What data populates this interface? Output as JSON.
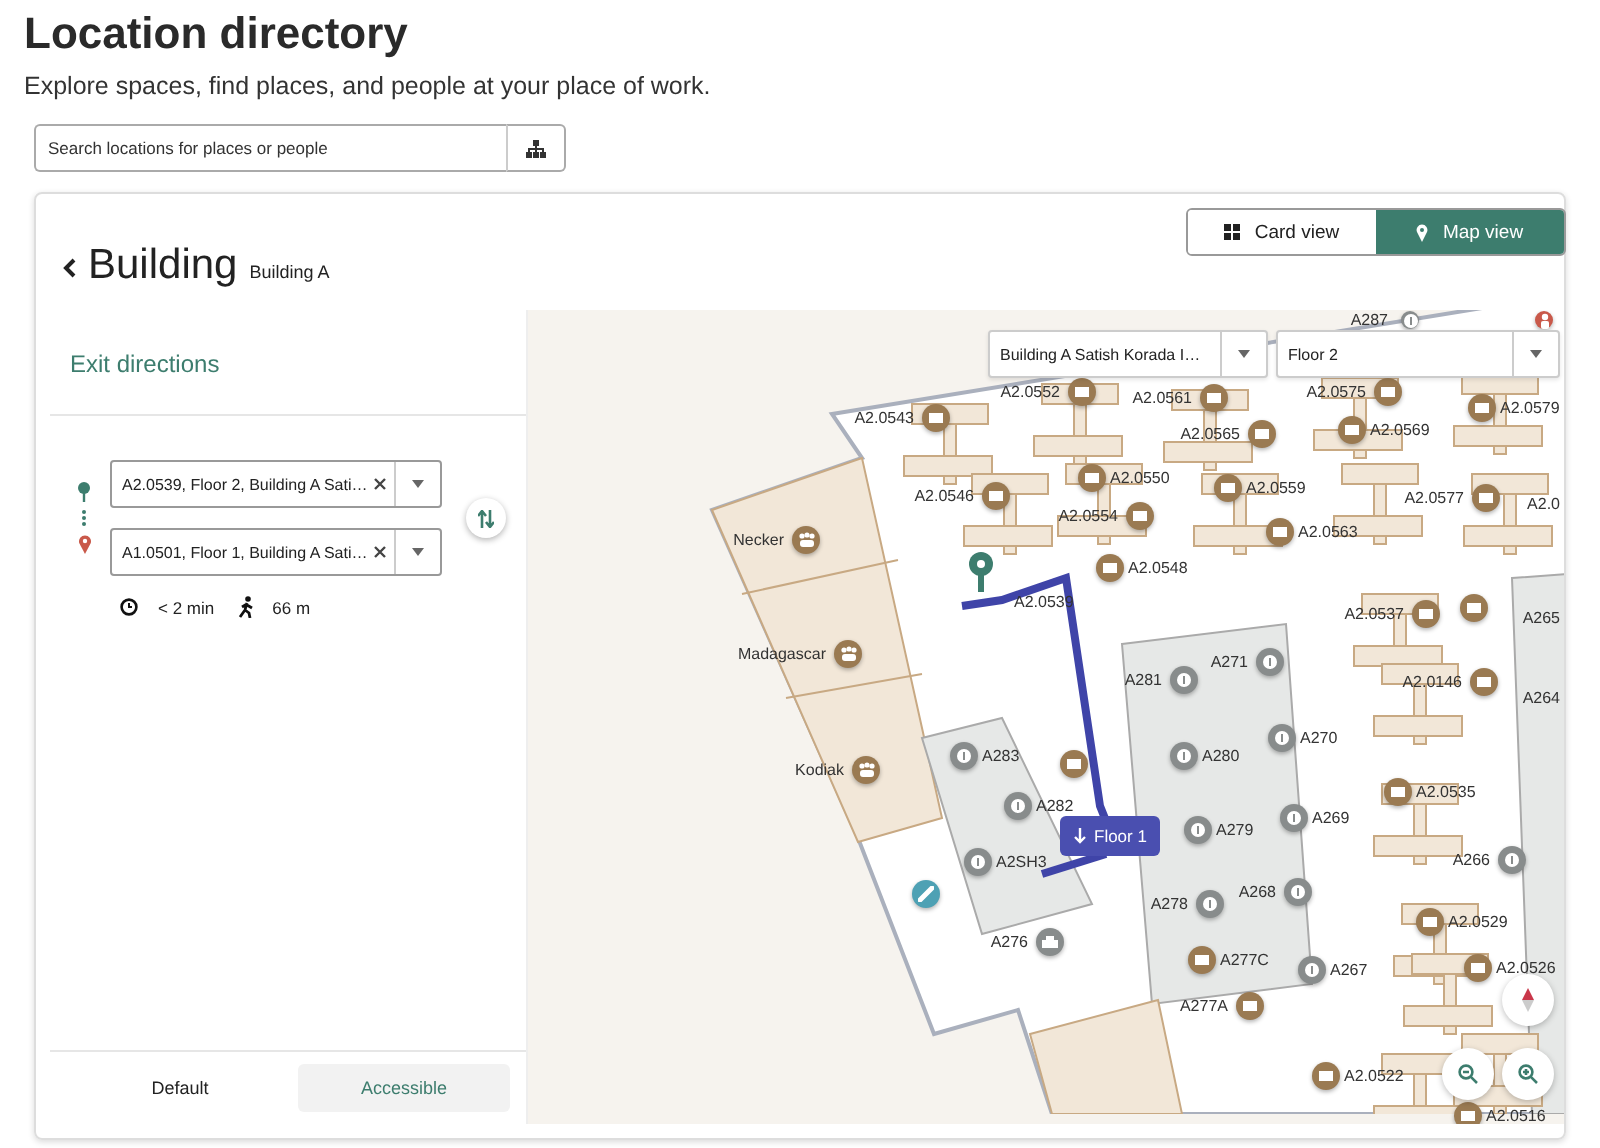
{
  "page": {
    "title": "Location directory",
    "subtitle": "Explore spaces, find places, and people at your place of work."
  },
  "search": {
    "placeholder": "Search locations for places or people"
  },
  "building": {
    "heading": "Building",
    "subtitle": "Building A"
  },
  "view_toggle": [
    {
      "label": "Card view",
      "selected": false
    },
    {
      "label": "Map view",
      "selected": true
    }
  ],
  "directions": {
    "title": "Exit directions",
    "from": "A2.0539, Floor 2, Building A Sati…",
    "to": "A1.0501, Floor 1, Building A Sati…",
    "duration": "< 2 min",
    "distance": "66 m"
  },
  "route_modes": [
    {
      "label": "Default",
      "selected": false
    },
    {
      "label": "Accessible",
      "selected": true
    }
  ],
  "map": {
    "building_select": "Building A Satish Korada I…",
    "floor_select": "Floor 2",
    "floor_change": "Floor 1",
    "route_start": "A2.0539",
    "places": [
      {
        "label": "A287",
        "kind": "info"
      },
      {
        "kind": "alert"
      },
      {
        "label": "A2.0552",
        "kind": "desk"
      },
      {
        "label": "A2.0543",
        "kind": "desk"
      },
      {
        "label": "A2.0561",
        "kind": "desk"
      },
      {
        "label": "A2.0575",
        "kind": "desk"
      },
      {
        "label": "A2.0579",
        "kind": "desk"
      },
      {
        "label": "A2.0565",
        "kind": "desk"
      },
      {
        "label": "A2.0569",
        "kind": "desk"
      },
      {
        "label": "A2.0546",
        "kind": "desk"
      },
      {
        "label": "A2.0550",
        "kind": "desk"
      },
      {
        "label": "A2.0559",
        "kind": "desk"
      },
      {
        "label": "A2.0577",
        "kind": "desk"
      },
      {
        "label": "A2.0",
        "kind": "text"
      },
      {
        "label": "A2.0554",
        "kind": "desk"
      },
      {
        "label": "A2.0563",
        "kind": "desk"
      },
      {
        "label": "A2.0548",
        "kind": "desk"
      },
      {
        "label": "Necker",
        "kind": "room"
      },
      {
        "label": "Madagascar",
        "kind": "room"
      },
      {
        "label": "Kodiak",
        "kind": "room"
      },
      {
        "label": "A2.0537",
        "kind": "desk"
      },
      {
        "kind": "desk"
      },
      {
        "label": "A265",
        "kind": "text"
      },
      {
        "label": "A281",
        "kind": "info"
      },
      {
        "label": "A271",
        "kind": "info"
      },
      {
        "label": "A2.0146",
        "kind": "desk"
      },
      {
        "label": "A264",
        "kind": "text"
      },
      {
        "label": "A280",
        "kind": "info"
      },
      {
        "label": "A270",
        "kind": "info"
      },
      {
        "label": "A283",
        "kind": "info"
      },
      {
        "kind": "desk"
      },
      {
        "label": "A282",
        "kind": "info"
      },
      {
        "label": "A2.0535",
        "kind": "desk"
      },
      {
        "label": "A279",
        "kind": "info"
      },
      {
        "label": "A269",
        "kind": "info"
      },
      {
        "label": "A2SH3",
        "kind": "info"
      },
      {
        "label": "A266",
        "kind": "info"
      },
      {
        "kind": "stairs"
      },
      {
        "label": "A278",
        "kind": "info"
      },
      {
        "label": "A268",
        "kind": "info"
      },
      {
        "label": "A2.0529",
        "kind": "desk"
      },
      {
        "label": "A276",
        "kind": "printer"
      },
      {
        "label": "A277C",
        "kind": "desk"
      },
      {
        "label": "A2.0526",
        "kind": "desk"
      },
      {
        "label": "A267",
        "kind": "info"
      },
      {
        "label": "A277A",
        "kind": "desk"
      },
      {
        "label": "A2.0522",
        "kind": "desk"
      },
      {
        "label": "A2.0516",
        "kind": "desk"
      }
    ]
  }
}
